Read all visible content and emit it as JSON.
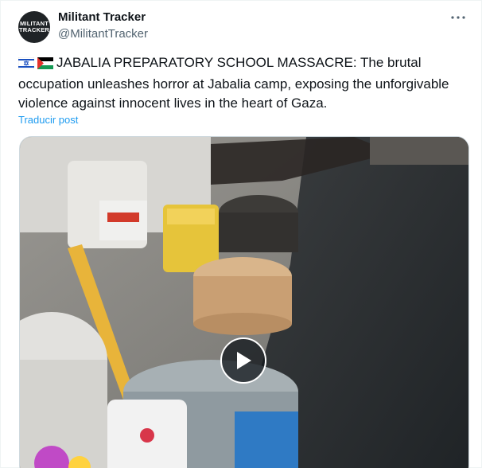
{
  "account": {
    "avatar_text_line1": "MILITANT",
    "avatar_text_line2": "TRACKER",
    "display_name": "Militant Tracker",
    "handle": "@MilitantTracker"
  },
  "post": {
    "flag_icons": [
      "israel-flag-icon",
      "palestine-flag-icon"
    ],
    "text": "JABALIA PREPARATORY SCHOOL MASSACRE: The brutal occupation unleashes horror at Jabalia camp, exposing the unforgivable violence against innocent lives in the heart of Gaza.",
    "translate_label": "Traducir post"
  },
  "media": {
    "type": "video",
    "play_icon": "play-icon"
  },
  "menu_icon": "more-options-icon",
  "colors": {
    "link": "#1d9bf0",
    "secondary_text": "#536471",
    "primary_text": "#0f1419",
    "border": "#cfd9de"
  }
}
